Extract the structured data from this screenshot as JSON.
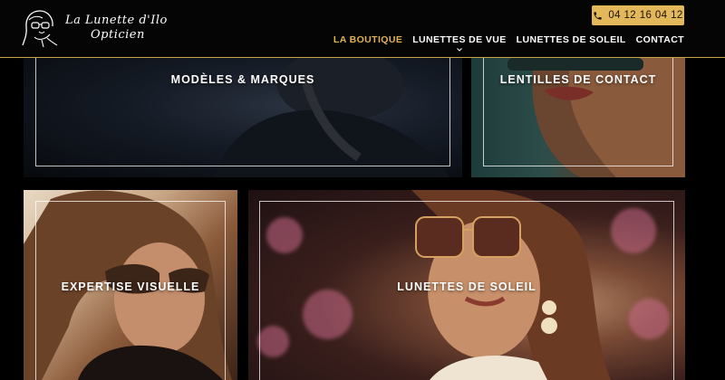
{
  "brand": {
    "line1": "La Lunette d'Ilo",
    "line2": "Opticien"
  },
  "header": {
    "phone": "04 12 16 04 12",
    "nav": [
      {
        "label": "LA BOUTIQUE",
        "active": true
      },
      {
        "label": "LUNETTES DE VUE",
        "has_dropdown": true
      },
      {
        "label": "LUNETTES DE SOLEIL"
      },
      {
        "label": "CONTACT"
      }
    ]
  },
  "tiles": [
    {
      "label": "MODÈLES & MARQUES"
    },
    {
      "label": "LENTILLES DE CONTACT"
    },
    {
      "label": "EXPERTISE VISUELLE"
    },
    {
      "label": "LUNETTES DE SOLEIL"
    }
  ],
  "colors": {
    "accent": "#e3b85a",
    "nav_active": "#e0b252",
    "background": "#000000"
  }
}
